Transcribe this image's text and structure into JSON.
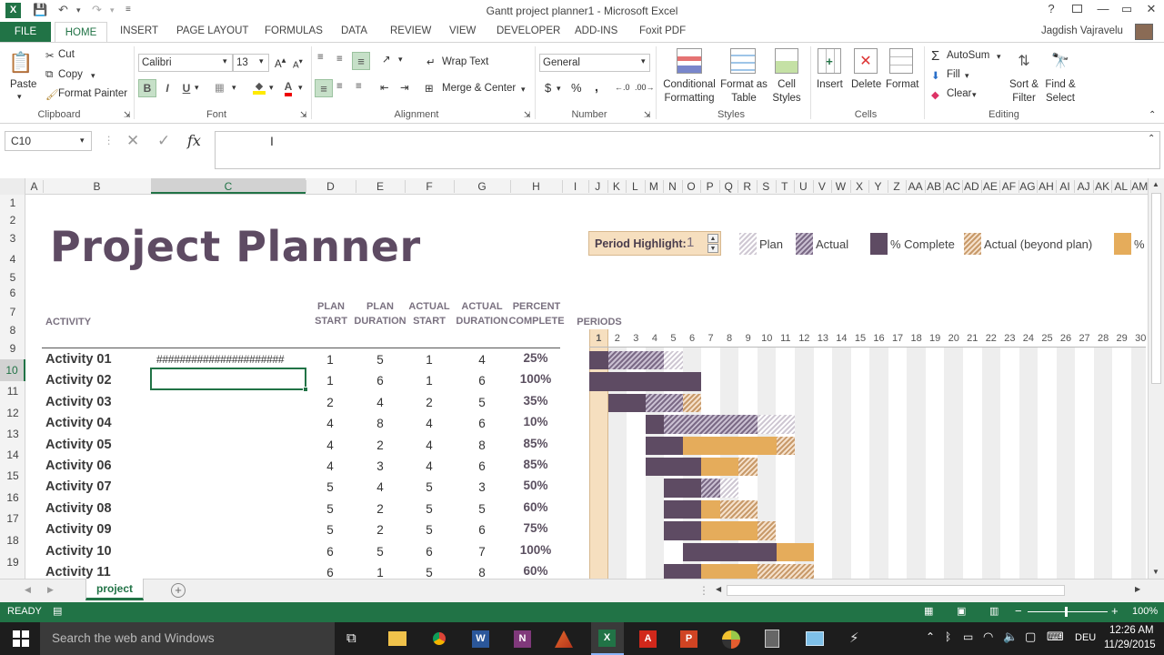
{
  "window": {
    "title": "Gantt project planner1 - Microsoft Excel",
    "controls": {
      "help": "?",
      "minimize": "—",
      "restore": "▭",
      "close": "✕"
    }
  },
  "tabs": [
    "FILE",
    "HOME",
    "INSERT",
    "PAGE LAYOUT",
    "FORMULAS",
    "DATA",
    "REVIEW",
    "VIEW",
    "DEVELOPER",
    "ADD-INS",
    "Foxit PDF"
  ],
  "user": "Jagdish Vajravelu",
  "ribbon": {
    "clipboard": {
      "paste": "Paste",
      "cut": "Cut",
      "copy": "Copy",
      "format_painter": "Format Painter",
      "label": "Clipboard"
    },
    "font": {
      "name": "Calibri",
      "size": "13",
      "bold": "B",
      "italic": "I",
      "underline": "U",
      "label": "Font"
    },
    "alignment": {
      "wrap": "Wrap Text",
      "merge": "Merge & Center",
      "label": "Alignment"
    },
    "number": {
      "format": "General",
      "currency": "$",
      "percent": "%",
      "comma": ",",
      "label": "Number"
    },
    "styles": {
      "conditional": "Conditional Formatting",
      "format_table": "Format as Table",
      "cell_styles": "Cell Styles",
      "label": "Styles"
    },
    "cells": {
      "insert": "Insert",
      "delete": "Delete",
      "format": "Format",
      "label": "Cells"
    },
    "editing": {
      "autosum": "AutoSum",
      "fill": "Fill",
      "clear": "Clear",
      "sort": "Sort & Filter",
      "find": "Find & Select",
      "label": "Editing"
    }
  },
  "formula_bar": {
    "name_box": "C10",
    "fx": "fx",
    "value": ""
  },
  "columns": [
    "A",
    "B",
    "C",
    "D",
    "E",
    "F",
    "G",
    "H",
    "I",
    "J",
    "K",
    "L",
    "M",
    "N",
    "O",
    "P",
    "Q",
    "R",
    "S",
    "T",
    "U",
    "V",
    "W",
    "X",
    "Y",
    "Z",
    "AA",
    "AB",
    "AC",
    "AD",
    "AE",
    "AF",
    "AG",
    "AH",
    "AI",
    "AJ",
    "AK",
    "AL",
    "AM"
  ],
  "rows": [
    "1",
    "2",
    "3",
    "4",
    "5",
    "6",
    "7",
    "8",
    "9",
    "10",
    "11",
    "12",
    "13",
    "14",
    "15",
    "16",
    "17",
    "18",
    "19"
  ],
  "sheet": {
    "title": "Project Planner",
    "period_highlight_label": "Period Highlight:",
    "period_highlight_value": "1",
    "legend": [
      "Plan",
      "Actual",
      "% Complete",
      "Actual (beyond plan)",
      "%"
    ],
    "headers": {
      "activity": "ACTIVITY",
      "plan_start": [
        "PLAN",
        "START"
      ],
      "plan_duration": [
        "PLAN",
        "DURATION"
      ],
      "actual_start": [
        "ACTUAL",
        "START"
      ],
      "actual_duration": [
        "ACTUAL",
        "DURATION"
      ],
      "percent_complete": [
        "PERCENT",
        "COMPLETE"
      ],
      "periods": "PERIODS"
    },
    "periods": [
      "1",
      "2",
      "3",
      "4",
      "5",
      "6",
      "7",
      "8",
      "9",
      "10",
      "11",
      "12",
      "13",
      "14",
      "15",
      "16",
      "17",
      "18",
      "19",
      "20",
      "21",
      "22",
      "23",
      "24",
      "25",
      "26",
      "27",
      "28",
      "29",
      "30"
    ],
    "c9_overflow": "######################",
    "activities": [
      {
        "name": "Activity 01",
        "plan_start": 1,
        "plan_duration": 5,
        "actual_start": 1,
        "actual_duration": 4,
        "percent": "25%"
      },
      {
        "name": "Activity 02",
        "plan_start": 1,
        "plan_duration": 6,
        "actual_start": 1,
        "actual_duration": 6,
        "percent": "100%"
      },
      {
        "name": "Activity 03",
        "plan_start": 2,
        "plan_duration": 4,
        "actual_start": 2,
        "actual_duration": 5,
        "percent": "35%"
      },
      {
        "name": "Activity 04",
        "plan_start": 4,
        "plan_duration": 8,
        "actual_start": 4,
        "actual_duration": 6,
        "percent": "10%"
      },
      {
        "name": "Activity 05",
        "plan_start": 4,
        "plan_duration": 2,
        "actual_start": 4,
        "actual_duration": 8,
        "percent": "85%"
      },
      {
        "name": "Activity 06",
        "plan_start": 4,
        "plan_duration": 3,
        "actual_start": 4,
        "actual_duration": 6,
        "percent": "85%"
      },
      {
        "name": "Activity 07",
        "plan_start": 5,
        "plan_duration": 4,
        "actual_start": 5,
        "actual_duration": 3,
        "percent": "50%"
      },
      {
        "name": "Activity 08",
        "plan_start": 5,
        "plan_duration": 2,
        "actual_start": 5,
        "actual_duration": 5,
        "percent": "60%"
      },
      {
        "name": "Activity 09",
        "plan_start": 5,
        "plan_duration": 2,
        "actual_start": 5,
        "actual_duration": 6,
        "percent": "75%"
      },
      {
        "name": "Activity 10",
        "plan_start": 6,
        "plan_duration": 5,
        "actual_start": 6,
        "actual_duration": 7,
        "percent": "100%"
      },
      {
        "name": "Activity 11",
        "plan_start": 6,
        "plan_duration": 1,
        "actual_start": 5,
        "actual_duration": 8,
        "percent": "60%"
      }
    ]
  },
  "sheet_tab": "project",
  "status": {
    "ready": "READY",
    "zoom": "100%"
  },
  "taskbar": {
    "search": "Search the web and Windows",
    "lang": "DEU",
    "time": "12:26 AM",
    "date": "11/29/2015"
  },
  "colors": {
    "excel_green": "#217346",
    "pc": "#5e4b63",
    "gold": "#e5ac5b",
    "period_highlight": "#f6dfbf"
  }
}
